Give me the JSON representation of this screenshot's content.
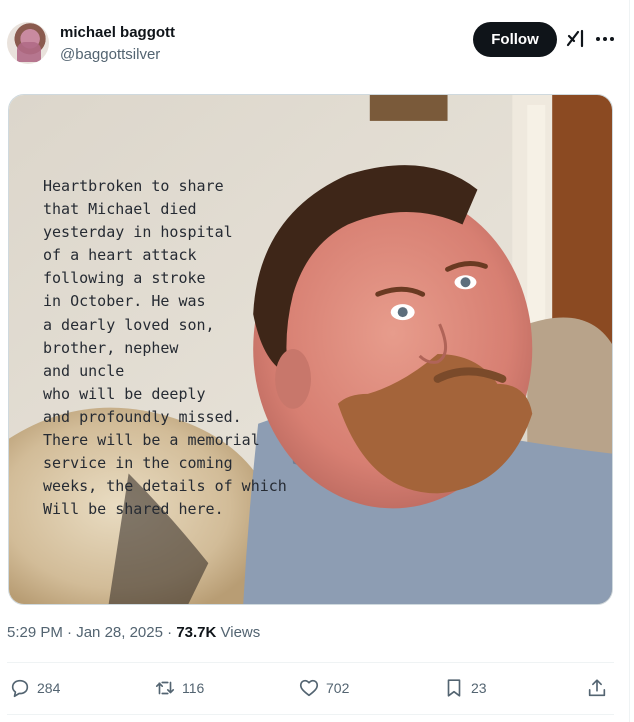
{
  "author": {
    "name": "michael baggott",
    "handle": "@baggottsilver"
  },
  "header": {
    "follow_label": "Follow",
    "grok_icon": "grok-icon",
    "more_icon": "more-icon"
  },
  "media": {
    "overlay_text": "Heartbroken to share\nthat Michael died\nyesterday in hospital\nof a heart attack\nfollowing a stroke\nin October. He was\na dearly loved son,\nbrother, nephew\nand uncle\nwho will be deeply\nand profoundly missed.\nThere will be a memorial\nservice in the coming\nweeks, the details of which\nWill be shared here."
  },
  "meta": {
    "time": "5:29 PM",
    "separator": "·",
    "date": "Jan 28, 2025",
    "views_count": "73.7K",
    "views_label": "Views"
  },
  "actions": {
    "replies": "284",
    "reposts": "116",
    "likes": "702",
    "bookmarks": "23"
  },
  "colors": {
    "text_primary": "#0f1419",
    "text_secondary": "#536471",
    "follow_bg": "#0f1419",
    "border": "#eff3f4"
  }
}
